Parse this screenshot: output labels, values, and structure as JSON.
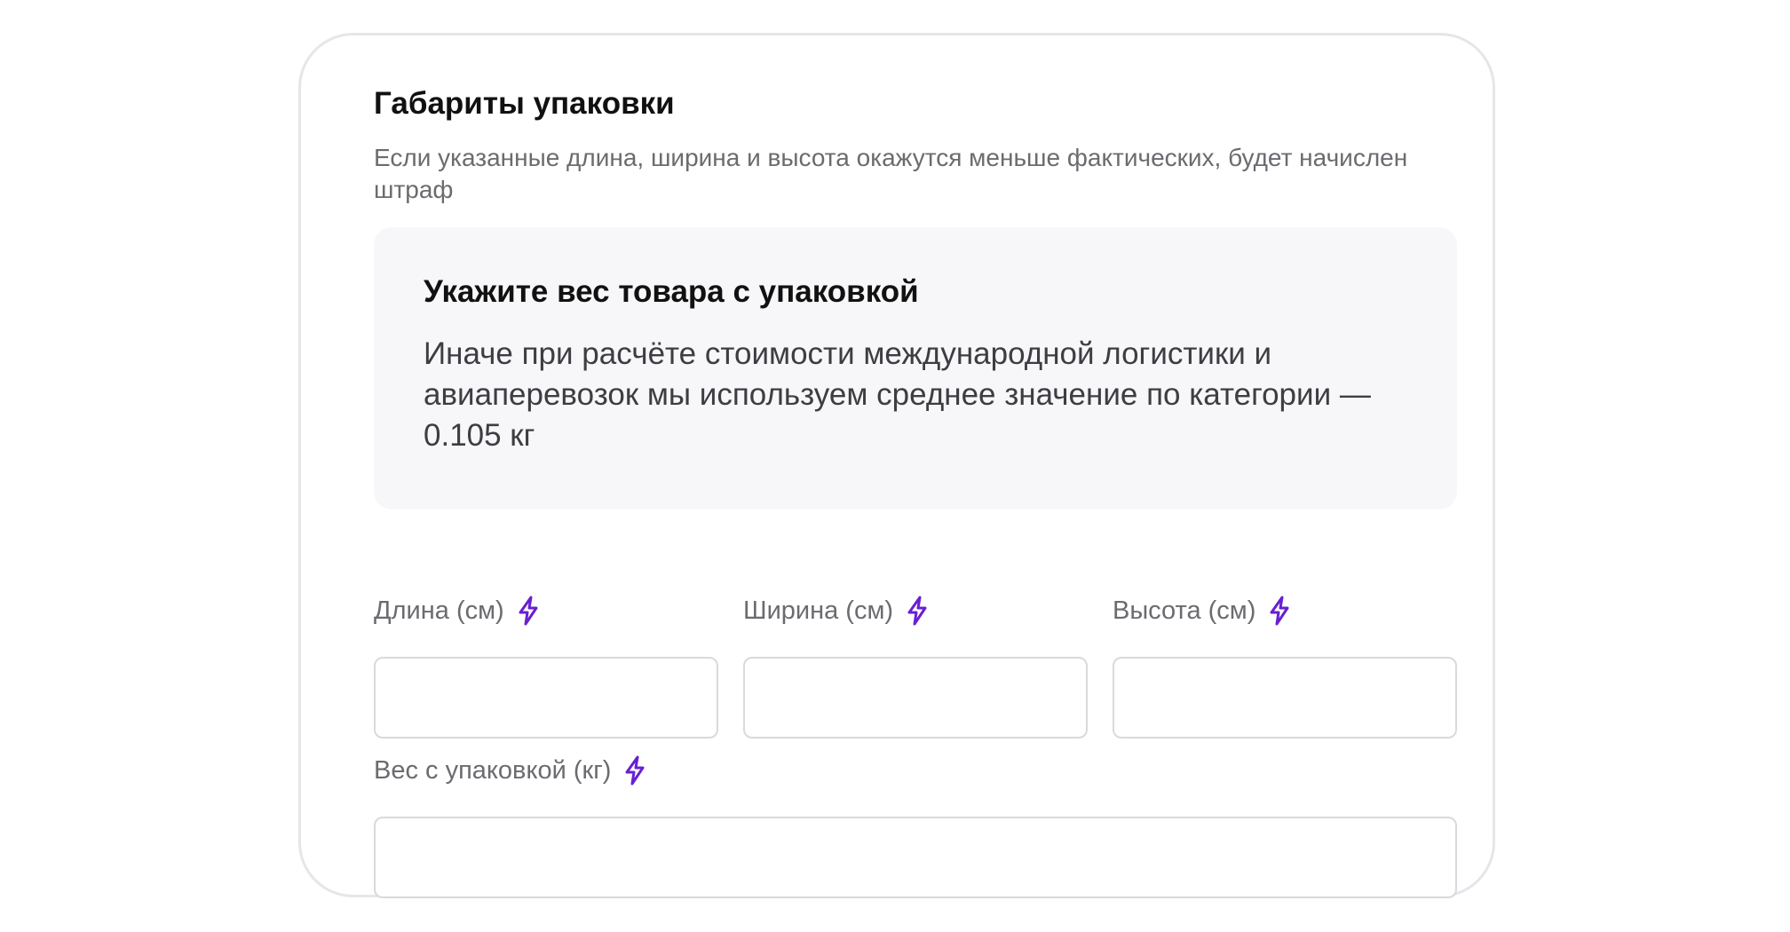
{
  "section": {
    "title": "Габариты упаковки",
    "description": "Если указанные длина, ширина и высота окажутся меньше фактических, будет начислен штраф"
  },
  "notice": {
    "title": "Укажите вес товара с упаковкой",
    "text": "Иначе при расчёте стоимости международной логистики и авиаперевозок мы используем среднее значение по категории — 0.105 кг"
  },
  "fields": {
    "length": {
      "label": "Длина (см)",
      "value": "",
      "icon": "lightning-icon"
    },
    "width": {
      "label": "Ширина (см)",
      "value": "",
      "icon": "lightning-icon"
    },
    "height": {
      "label": "Высота (см)",
      "value": "",
      "icon": "lightning-icon"
    },
    "weight": {
      "label": "Вес с упаковкой (кг)",
      "value": "",
      "icon": "lightning-icon"
    }
  },
  "colors": {
    "accent_icon": "#6a1fd1",
    "notice_background": "#f7f7f9",
    "input_border": "#d9d9de"
  }
}
